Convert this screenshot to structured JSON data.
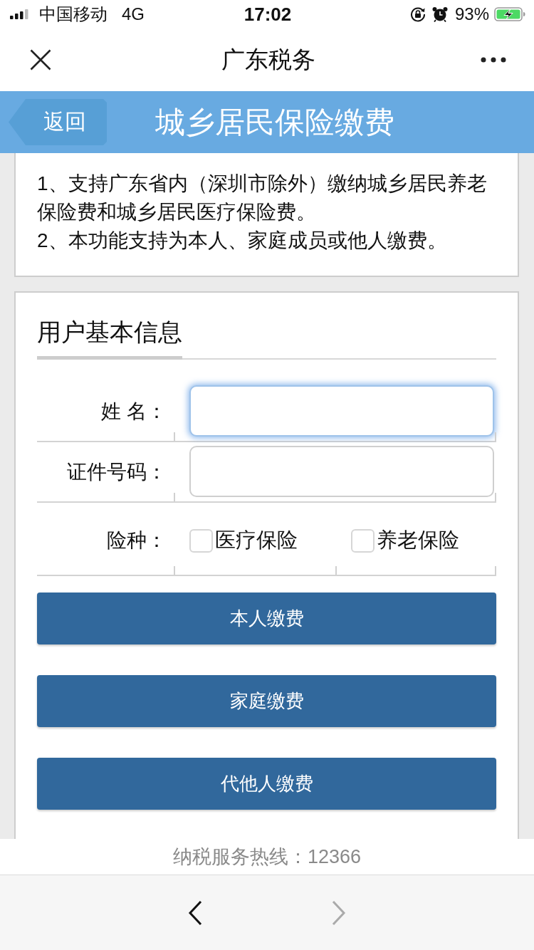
{
  "status_bar": {
    "carrier": "中国移动",
    "network": "4G",
    "time": "17:02",
    "battery": "93%"
  },
  "nav_bar": {
    "title": "广东税务"
  },
  "header": {
    "back_button": "返回",
    "title": "城乡居民保险缴费"
  },
  "notice": {
    "items": [
      "1、支持广东省内（深圳市除外）缴纳城乡居民养老保险费和城乡居民医疗保险费。",
      "2、本功能支持为本人、家庭成员或他人缴费。"
    ]
  },
  "form": {
    "title": "用户基本信息",
    "fields": [
      {
        "kind": "text",
        "label": "姓 名：",
        "focused": true
      },
      {
        "kind": "text",
        "label": "证件号码：",
        "focused": false
      },
      {
        "kind": "checkboxes",
        "label": "险种：",
        "options": [
          {
            "label": "医疗保险",
            "checked": false
          },
          {
            "label": "养老保险",
            "checked": false
          }
        ]
      }
    ],
    "buttons": [
      "本人缴费",
      "家庭缴费",
      "代他人缴费"
    ]
  },
  "footer": {
    "hotline": "纳税服务热线：12366"
  },
  "browser_toolbar": [
    {
      "kind": "back",
      "disabled": false
    },
    {
      "kind": "forward",
      "disabled": true
    }
  ]
}
